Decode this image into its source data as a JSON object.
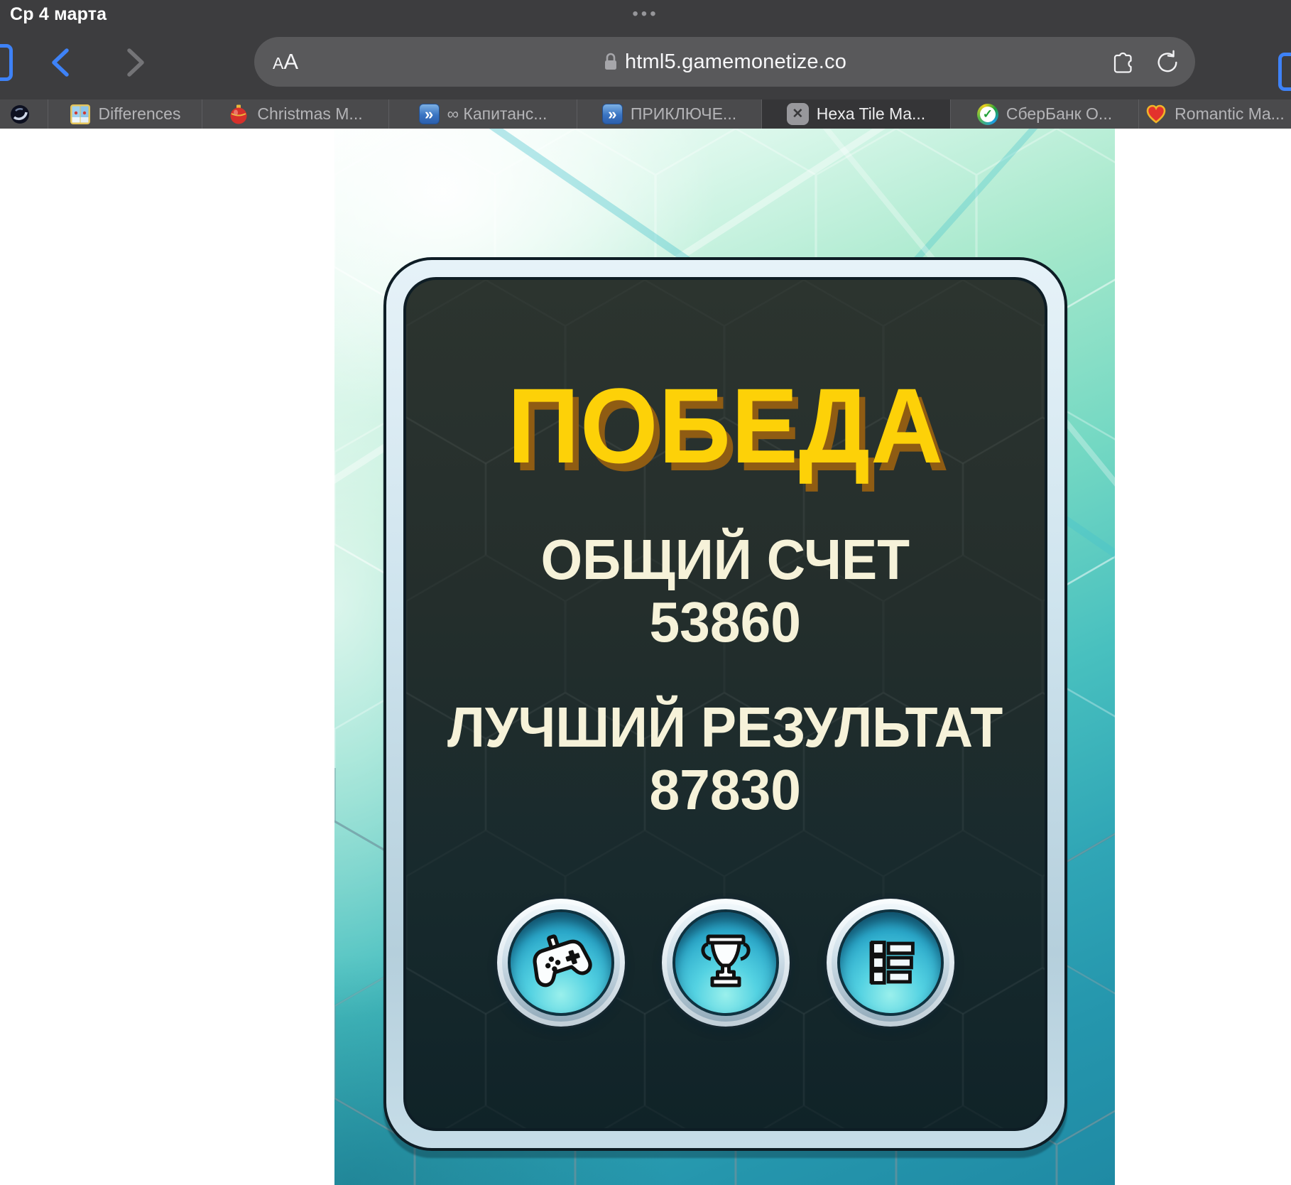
{
  "status_bar": {
    "date": "Ср 4 марта",
    "app_switcher_dots": "•••"
  },
  "toolbar": {
    "reader_button": "AA",
    "url": "html5.gamemonetize.co"
  },
  "tabs": [
    {
      "label": ""
    },
    {
      "label": "Differences"
    },
    {
      "label": "Christmas M..."
    },
    {
      "label": "∞ Капитанс..."
    },
    {
      "label": "ПРИКЛЮЧЕ..."
    },
    {
      "label": "Hexa Tile Ma...",
      "active": true,
      "close_glyph": "✕"
    },
    {
      "label": "СберБанк О..."
    },
    {
      "label": "Romantic Ma..."
    }
  ],
  "favicon_glyphs": {
    "chevrons": "»",
    "sber_check": "✓"
  },
  "game": {
    "title": "ПОБЕДА",
    "total_score_label": "ОБЩИЙ СЧЕТ",
    "total_score_value": "53860",
    "best_score_label": "ЛУЧШИЙ РЕЗУЛЬТАТ",
    "best_score_value": "87830",
    "buttons": [
      {
        "name": "play"
      },
      {
        "name": "achievements"
      },
      {
        "name": "leaderboard"
      }
    ]
  },
  "colors": {
    "title_yellow": "#fdd108",
    "title_shadow": "#8f5c13",
    "score_text": "#f6f2d9",
    "chrome_bg": "#3d3d3f",
    "accent_blue": "#3e82f7",
    "game_teal": "#2596ad"
  }
}
